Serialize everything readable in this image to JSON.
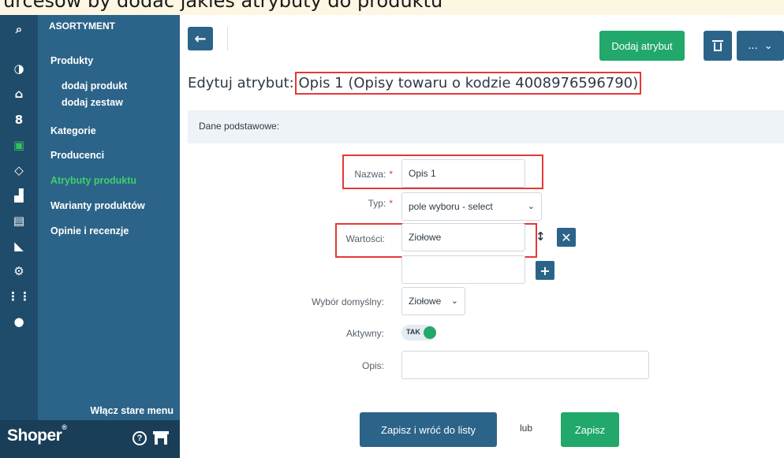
{
  "top_strip": {
    "text": "urcesów by dodać jakieś atrybuty do produktu"
  },
  "iconbar": {
    "icons": [
      "search-icon",
      "dashboard-icon",
      "cart-icon",
      "customers-icon",
      "assortment-icon",
      "tag-icon",
      "stats-icon",
      "content-icon",
      "image-icon",
      "settings-icon",
      "apps-icon",
      "payments-icon"
    ]
  },
  "sidebar": {
    "section_title": "ASORTYMENT",
    "items": [
      {
        "label": "Produkty"
      },
      {
        "label": "dodaj produkt"
      },
      {
        "label": "dodaj zestaw"
      },
      {
        "label": "Kategorie"
      },
      {
        "label": "Producenci"
      },
      {
        "label": "Atrybuty produktu"
      },
      {
        "label": "Warianty produktów"
      },
      {
        "label": "Opinie i recenzje"
      }
    ],
    "old_menu_label": "Włącz stare menu",
    "brand": "Shoper",
    "brand_mark": "®",
    "help_glyph": "?"
  },
  "toolbar": {
    "back_glyph": "←",
    "add_attribute_label": "Dodaj atrybut",
    "more_label": "...",
    "more_chevron": "⌄"
  },
  "page": {
    "title_prefix": "Edytuj atrybut: ",
    "title_highlight": "Opis 1 (Opisy towaru o kodzie 4008976596790)"
  },
  "form": {
    "section_label": "Dane podstawowe:",
    "required_mark": "*",
    "name_label": "Nazwa:",
    "name_value": "Opis 1",
    "type_label": "Typ:",
    "type_value": "pole wyboru - select",
    "values_label": "Wartości:",
    "value_1": "Ziołowe",
    "value_2": "",
    "default_label": "Wybór domyślny:",
    "default_value": "Ziołowe",
    "active_label": "Aktywny:",
    "active_value": "TAK",
    "description_label": "Opis:",
    "description_value": "",
    "chevron": "⌄",
    "remove_glyph": "✕",
    "add_glyph": "+",
    "reorder_glyph": "↕"
  },
  "actions": {
    "save_and_return_label": "Zapisz i wróć do listy",
    "or_label": "lub",
    "save_label": "Zapisz"
  },
  "colors": {
    "sidebar_dark": "#1f4c6b",
    "sidebar": "#2c6489",
    "accent_green": "#21a86a",
    "active_nav": "#3ed06a",
    "highlight_red": "#e53935"
  }
}
